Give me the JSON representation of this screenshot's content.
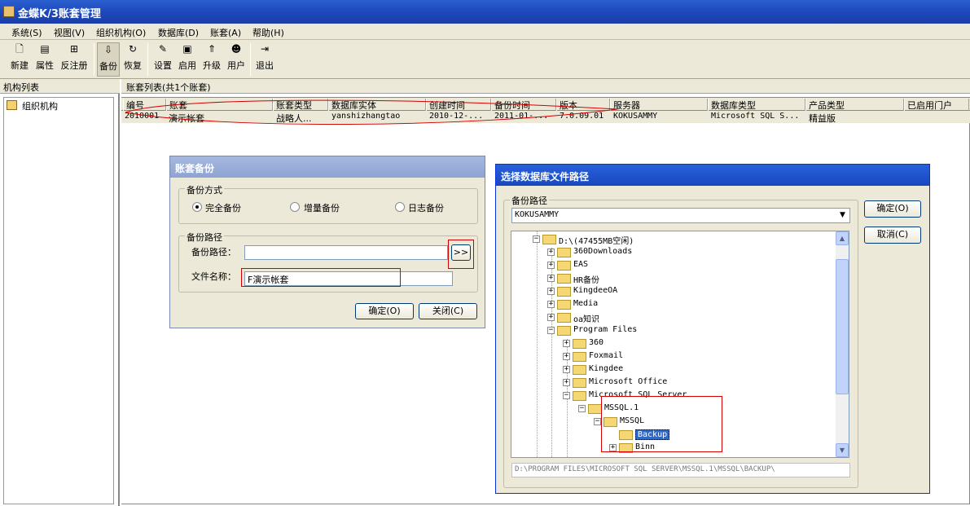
{
  "window": {
    "title": "金蝶K/3账套管理"
  },
  "menu": [
    "系统(S)",
    "视图(V)",
    "组织机构(O)",
    "数据库(D)",
    "账套(A)",
    "帮助(H)"
  ],
  "toolbar": {
    "new": "新建",
    "props": "属性",
    "unreg": "反注册",
    "backup": "备份",
    "restore": "恢复",
    "settings": "设置",
    "enable": "启用",
    "upgrade": "升级",
    "users": "用户",
    "exit": "退出"
  },
  "left": {
    "header": "机构列表",
    "root": "组织机构"
  },
  "list": {
    "header": "账套列表(共1个账套)",
    "columns": [
      "编号",
      "账套",
      "账套类型",
      "数据库实体",
      "创建时间",
      "备份时间",
      "版本",
      "服务器",
      "数据库类型",
      "产品类型",
      "已启用门户"
    ],
    "row": [
      "2010001",
      "演示帐套",
      "战略人...",
      "yanshizhangtao",
      "2010-12-...",
      "2011-01-...",
      "7.0.09.01",
      "KOKUSAMMY",
      "Microsoft SQL S...",
      "精益版",
      ""
    ]
  },
  "backup_dialog": {
    "title": "账套备份",
    "mode_group": "备份方式",
    "mode_full": "完全备份",
    "mode_incr": "增量备份",
    "mode_log": "日志备份",
    "path_group": "备份路径",
    "path_label": "备份路径：",
    "path_value": "",
    "browse": ">>",
    "file_label": "文件名称：",
    "file_value": "F演示帐套",
    "ok": "确定(O)",
    "close": "关闭(C)"
  },
  "path_dialog": {
    "title": "选择数据库文件路径",
    "group": "备份路径",
    "server": "KOKUSAMMY",
    "ok": "确定(O)",
    "cancel": "取消(C)",
    "tree": {
      "drive": "D:\\(47455MB空闲)",
      "d1": "360Downloads",
      "d2": "EAS",
      "d3": "HR备份",
      "d4": "KingdeeOA",
      "d5": "Media",
      "d6": "oa知识",
      "d7": "Program Files",
      "p1": "360",
      "p2": "Foxmail",
      "p3": "Kingdee",
      "p4": "Microsoft Office",
      "p5": "Microsoft SQL Server",
      "s1": "MSSQL.1",
      "s2": "MSSQL",
      "s3": "Backup",
      "s4": "Binn"
    },
    "path_status": "D:\\PROGRAM FILES\\MICROSOFT SQL SERVER\\MSSQL.1\\MSSQL\\BACKUP\\"
  }
}
